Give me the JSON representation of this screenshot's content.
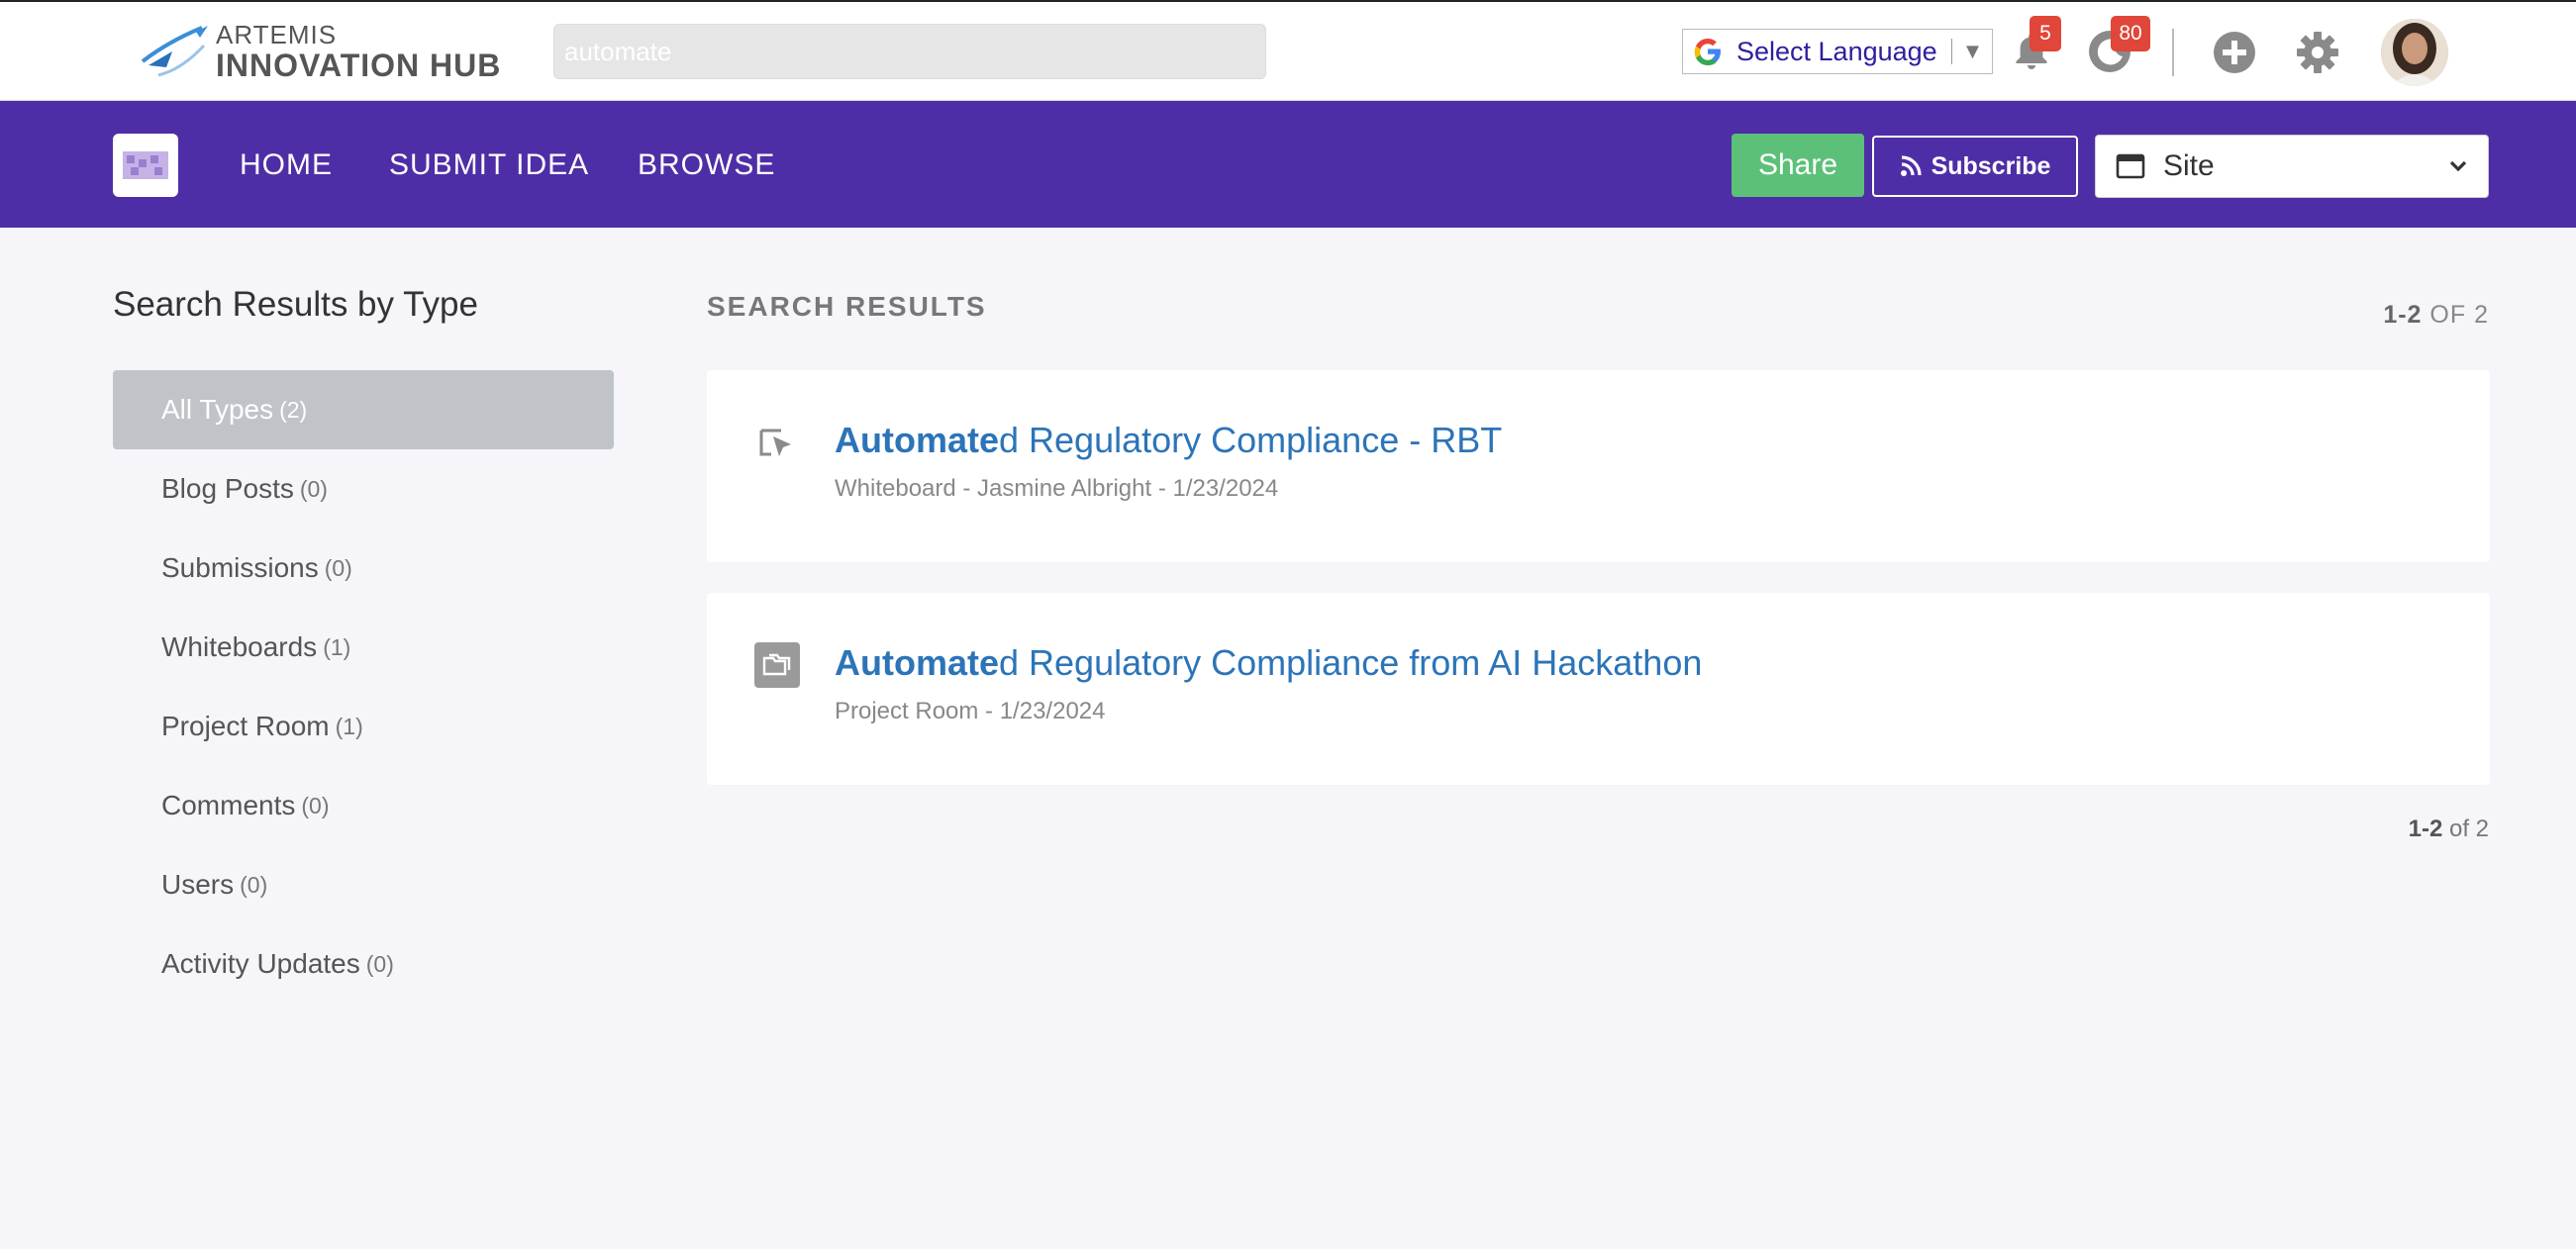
{
  "header": {
    "logo_top": "ARTEMIS",
    "logo_bottom": "INNOVATION HUB",
    "search_value": "automate",
    "language_label": "Select Language",
    "notifications_count": "5",
    "activity_count": "80"
  },
  "nav": {
    "links": [
      "HOME",
      "SUBMIT IDEA",
      "BROWSE"
    ],
    "share_label": "Share",
    "subscribe_label": "Subscribe",
    "site_select_value": "Site",
    "bar_color": "#4e2ea6"
  },
  "sidebar": {
    "title": "Search Results by Type",
    "items": [
      {
        "label": "All Types",
        "count": "(2)",
        "active": true
      },
      {
        "label": "Blog Posts",
        "count": "(0)"
      },
      {
        "label": "Submissions",
        "count": "(0)"
      },
      {
        "label": "Whiteboards",
        "count": "(1)"
      },
      {
        "label": "Project Room",
        "count": "(1)"
      },
      {
        "label": "Comments",
        "count": "(0)"
      },
      {
        "label": "Users",
        "count": "(0)"
      },
      {
        "label": "Activity Updates",
        "count": "(0)"
      }
    ]
  },
  "results": {
    "title": "SEARCH RESULTS",
    "range": "1-2",
    "of_label": "OF 2",
    "bottom_range": "1-2",
    "bottom_of_label": "of 2",
    "items": [
      {
        "highlight": "Automate",
        "rest": "d Regulatory Compliance - RBT",
        "meta": "Whiteboard - Jasmine Albright - 1/23/2024",
        "icon": "whiteboard-icon"
      },
      {
        "highlight": "Automate",
        "rest": "d Regulatory Compliance from AI Hackathon",
        "meta": "Project Room - 1/23/2024",
        "icon": "project-room-icon"
      }
    ]
  }
}
